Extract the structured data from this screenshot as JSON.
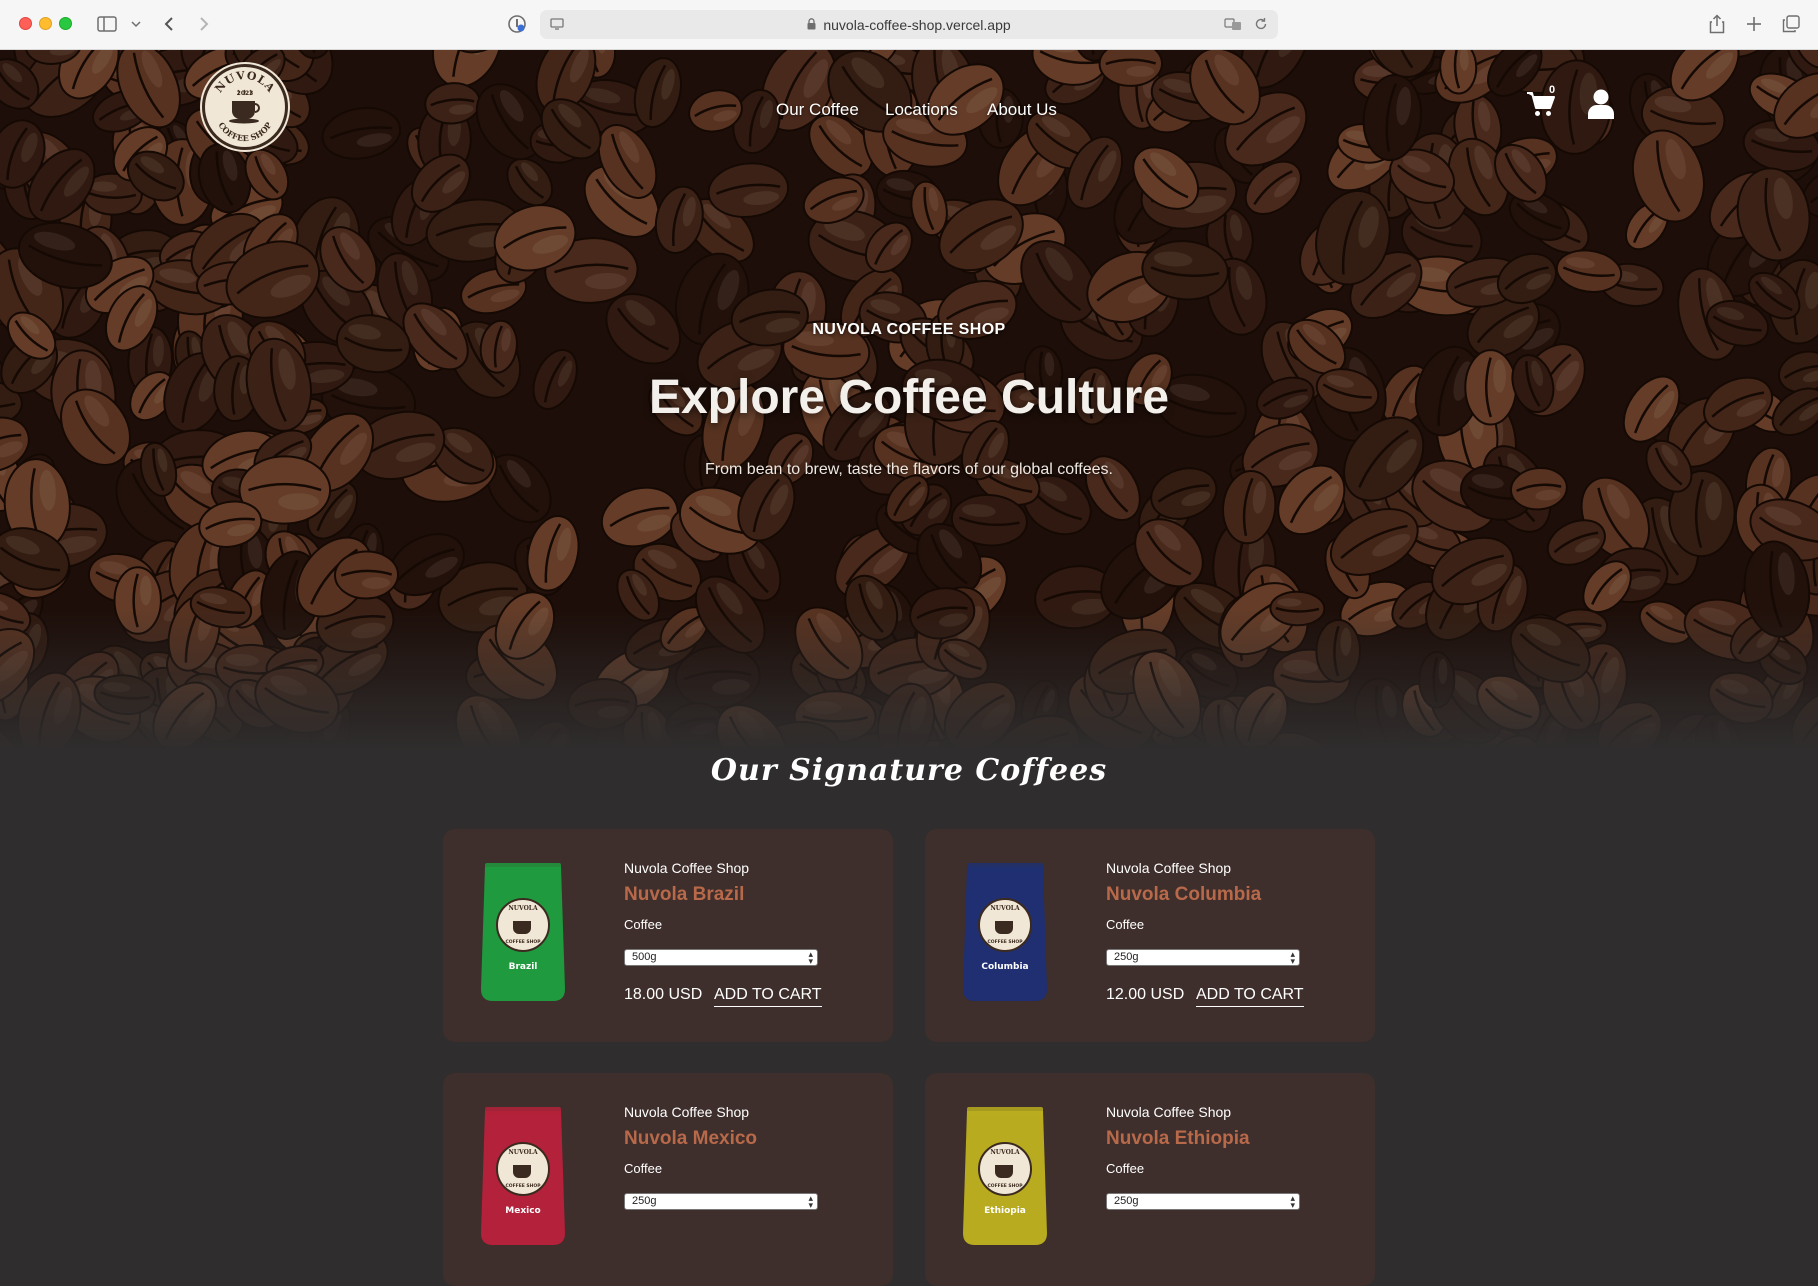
{
  "browser": {
    "url": "nuvola-coffee-shop.vercel.app"
  },
  "header": {
    "logo": {
      "top_text": "NUVOLA",
      "year": "2023",
      "bottom_text": "COFFEE SHOP"
    },
    "nav": [
      {
        "label": "Our Coffee"
      },
      {
        "label": "Locations"
      },
      {
        "label": "About Us"
      }
    ],
    "cart_count": "0"
  },
  "hero": {
    "eyebrow": "NUVOLA COFFEE SHOP",
    "title": "Explore Coffee Culture",
    "subtitle": "From bean to brew, taste the flavors of our global coffees."
  },
  "section": {
    "title": "Our Signature Coffees"
  },
  "products": [
    {
      "brand": "Nuvola Coffee Shop",
      "name": "Nuvola Brazil",
      "category": "Coffee",
      "size": "500g",
      "price": "18.00 USD",
      "cta": "ADD TO CART",
      "bag_label": "Brazil",
      "bag_color": "#1f9a3f"
    },
    {
      "brand": "Nuvola Coffee Shop",
      "name": "Nuvola Columbia",
      "category": "Coffee",
      "size": "250g",
      "price": "12.00 USD",
      "cta": "ADD TO CART",
      "bag_label": "Columbia",
      "bag_color": "#1f2f72"
    },
    {
      "brand": "Nuvola Coffee Shop",
      "name": "Nuvola Mexico",
      "category": "Coffee",
      "size": "250g",
      "bag_label": "Mexico",
      "bag_color": "#b3213a"
    },
    {
      "brand": "Nuvola Coffee Shop",
      "name": "Nuvola Ethiopia",
      "category": "Coffee",
      "size": "250g",
      "bag_label": "Ethiopia",
      "bag_color": "#b8ab1f"
    }
  ],
  "colors": {
    "page_bg": "#2f2d2d",
    "card_bg": "#3e2f2c",
    "product_name": "#b8694a"
  }
}
